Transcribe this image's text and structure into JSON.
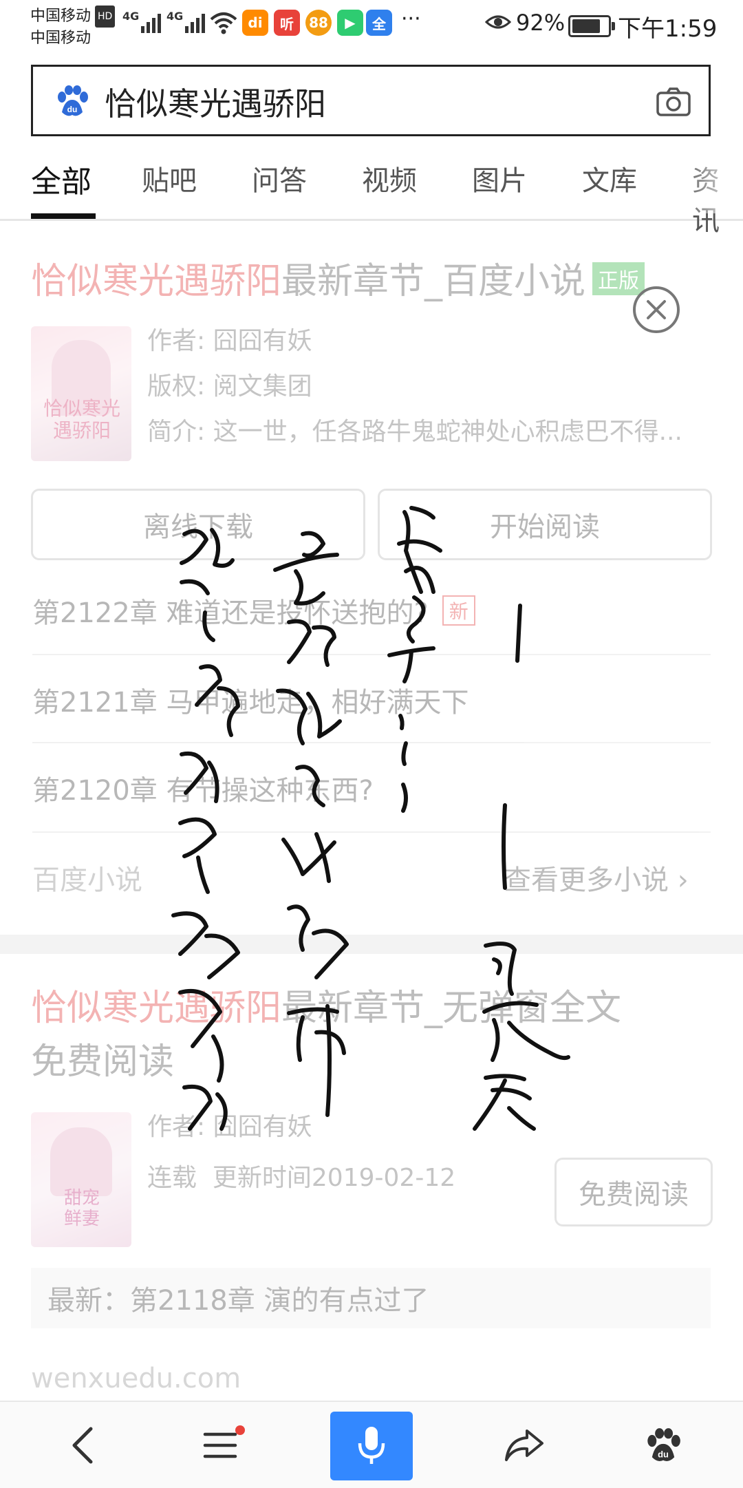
{
  "status_bar": {
    "carrier1": "中国移动",
    "carrier2": "中国移动",
    "hd_label": "HD",
    "network1": "4G",
    "network2": "4G",
    "battery_percent": "92%",
    "battery_level": 0.92,
    "time": "下午1:59",
    "overflow": "···",
    "app_icons": [
      {
        "name": "didi-app-icon",
        "glyph": "di",
        "color": "#ff8a00"
      },
      {
        "name": "tingshu-app-icon",
        "glyph": "听",
        "color": "#e8423a"
      },
      {
        "name": "game-app-icon",
        "glyph": "88",
        "color": "#f39c12"
      },
      {
        "name": "video-app-icon",
        "glyph": "▶",
        "color": "#2ecc71"
      },
      {
        "name": "quanmin-app-icon",
        "glyph": "全",
        "color": "#2f80ed"
      }
    ]
  },
  "search": {
    "query": "恰似寒光遇骄阳"
  },
  "tabs": [
    "全部",
    "贴吧",
    "问答",
    "视频",
    "图片",
    "文库",
    "资讯"
  ],
  "result1": {
    "title_highlight": "恰似寒光遇骄阳",
    "title_rest": "最新章节_百度小说",
    "official_badge": "正版",
    "author": "作者: 囧囧有妖",
    "copyright": "版权: 阅文集团",
    "intro": "简介: 这一世，任各路牛鬼蛇神处心积虑巴不得...",
    "offline_button": "离线下载",
    "read_button": "开始阅读",
    "chapters": [
      {
        "title": "第2122章 难道还是投怀送抱的?",
        "badge": "新"
      },
      {
        "title": "第2121章 马甲遍地走，相好满天下",
        "badge": ""
      },
      {
        "title": "第2120章 有节操这种东西?",
        "badge": ""
      }
    ],
    "source": "百度小说",
    "more_link": "查看更多小说"
  },
  "result2": {
    "title_highlight": "恰似寒光遇骄阳",
    "title_rest": "最新章节_无弹窗全文",
    "title_line2": "免费阅读",
    "author": "作者: 囧囧有妖",
    "status": "连载",
    "update_time": "更新时间2019-02-12",
    "free_read_button": "免费阅读",
    "latest": "最新：第2118章 演的有点过了",
    "url": "wenxuedu.com"
  },
  "bottom_nav": {
    "items": [
      "back",
      "menu",
      "voice",
      "share",
      "baidu-home"
    ]
  },
  "colors": {
    "highlight_red": "#e03a3a",
    "badge_green": "#3bb84a",
    "mic_blue": "#3388ff"
  }
}
